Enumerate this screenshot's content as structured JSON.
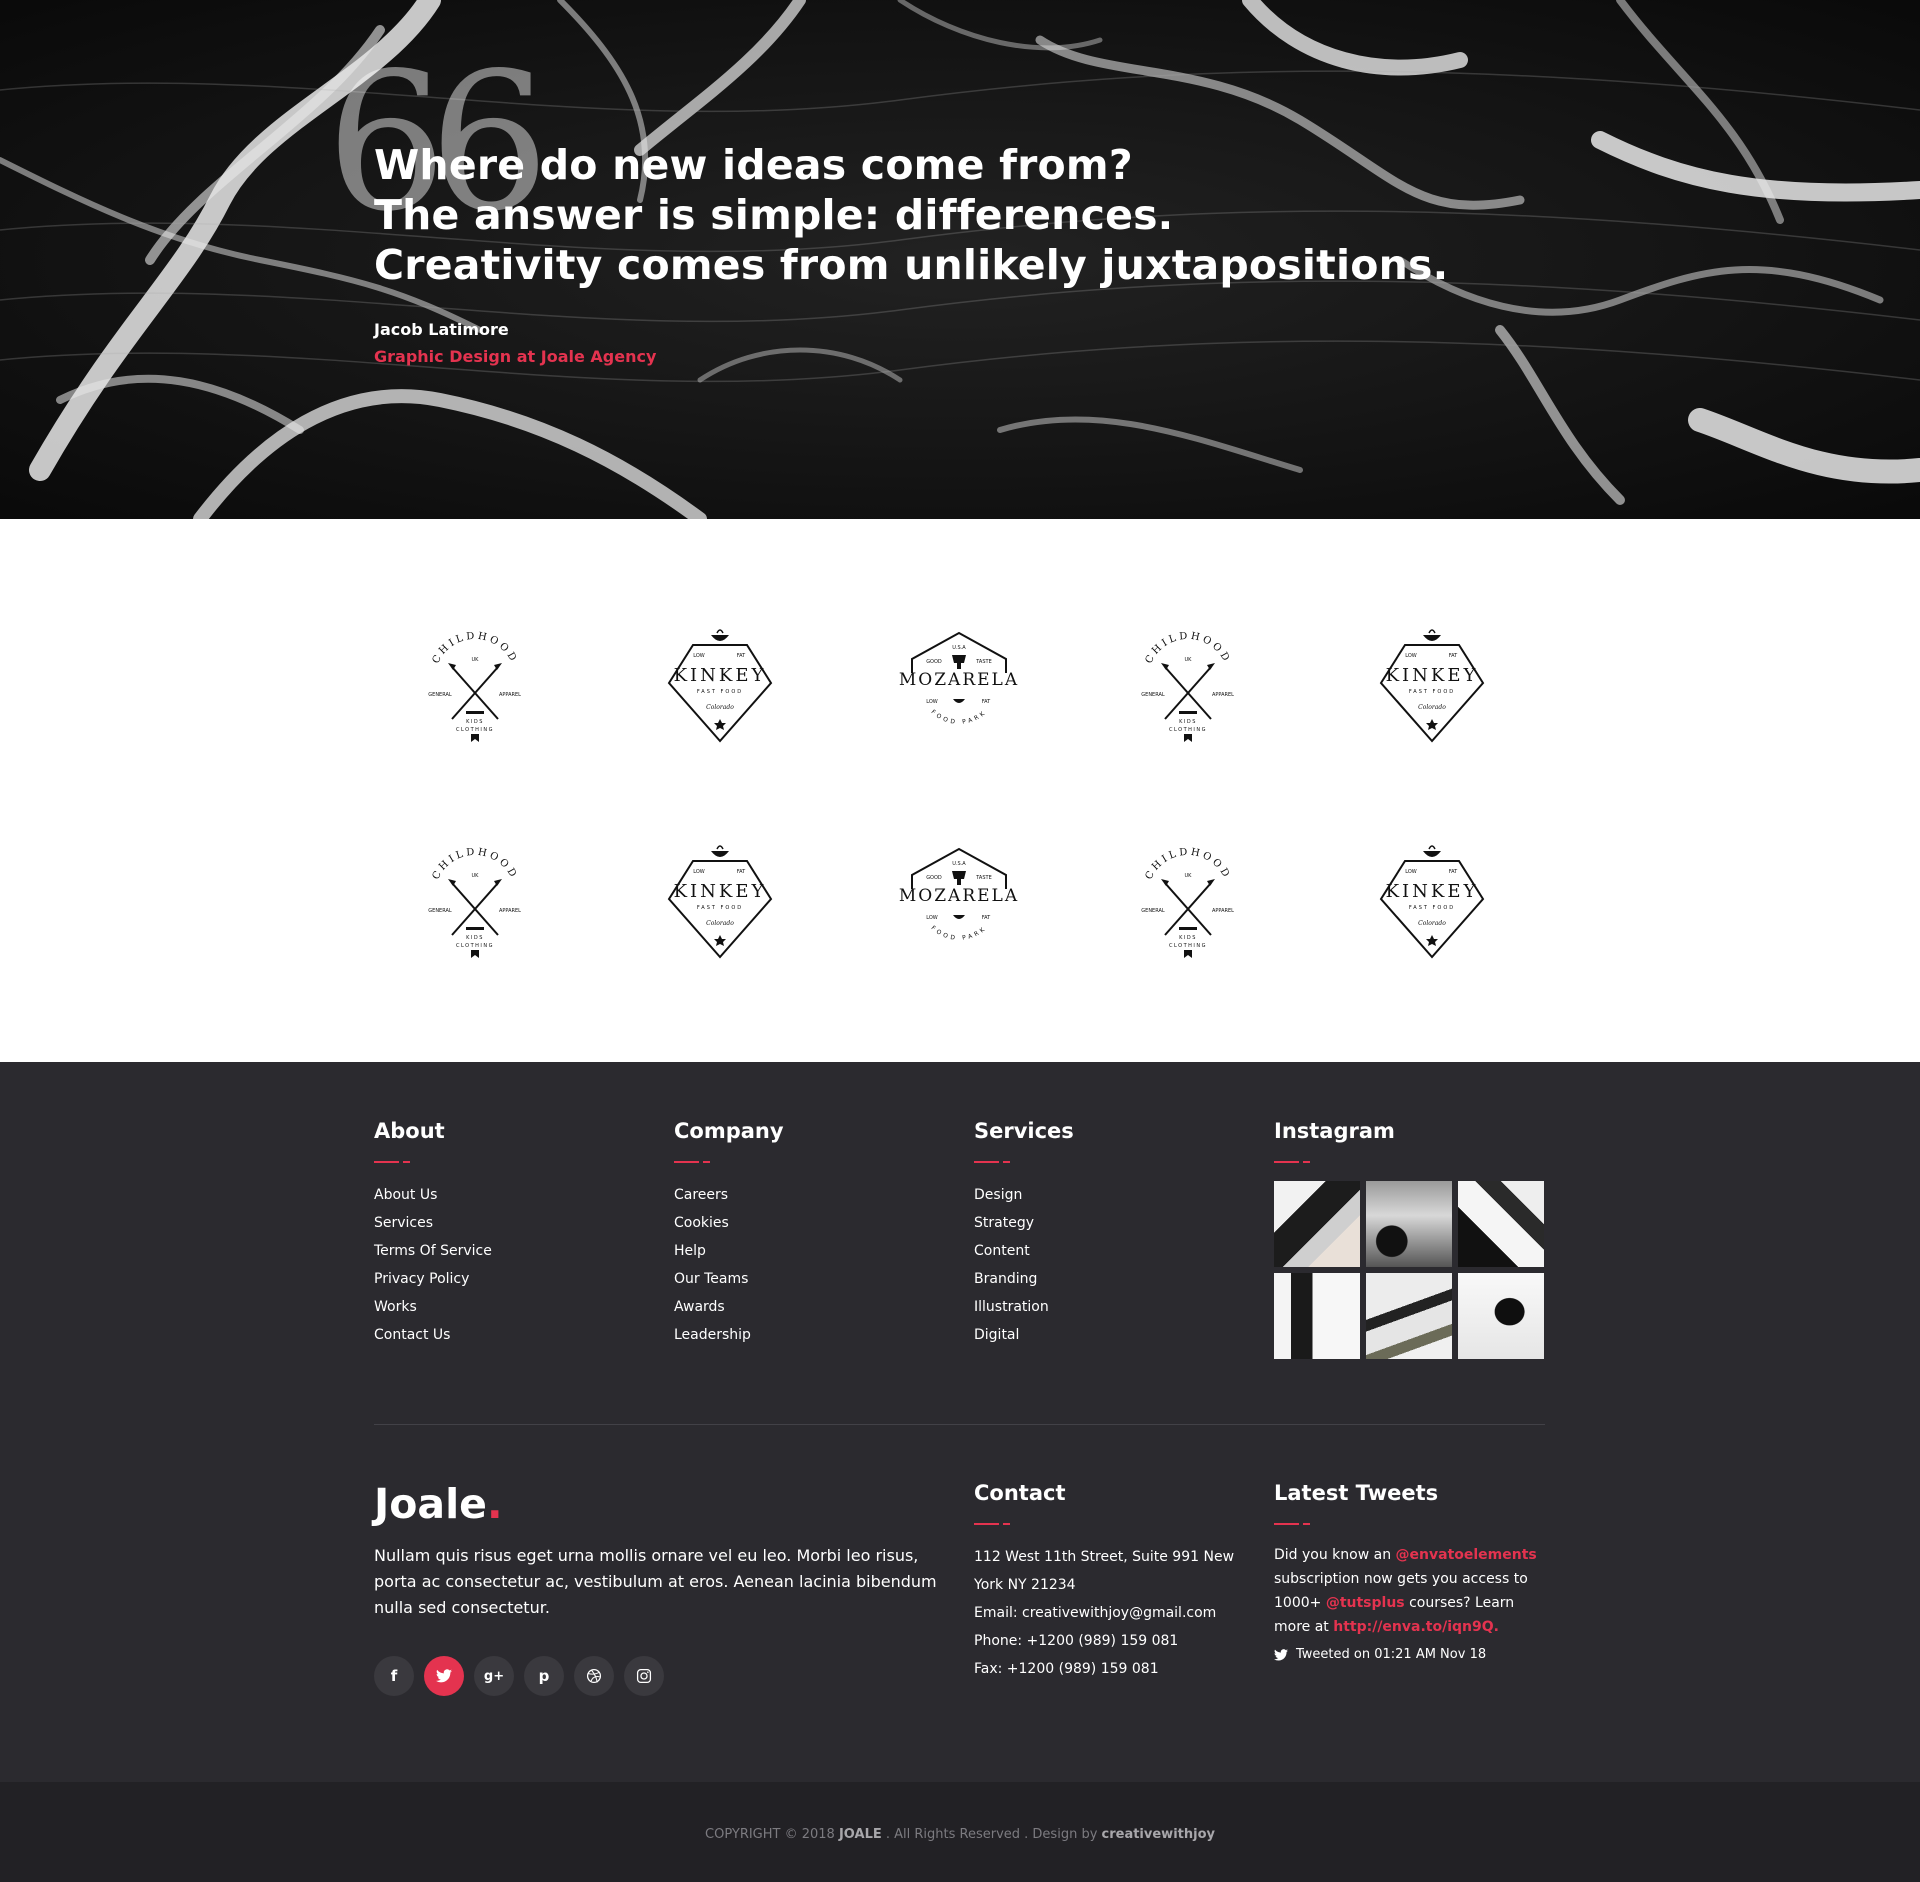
{
  "hero": {
    "quote_mark": "66",
    "quote_lines": [
      "Where do new ideas come from?",
      "The answer is simple: differences.",
      "Creativity comes from unlikely juxtapositions."
    ],
    "author": "Jacob Latimore",
    "role": "Graphic Design at Joale Agency"
  },
  "logos": [
    {
      "name": "CHILDHOOD",
      "top": "CHILDHOOD",
      "sub": "UK",
      "left": "GENERAL",
      "right": "APPAREL",
      "bottom1": "KIDS",
      "bottom2": "CLOTHING"
    },
    {
      "name": "KINKEY",
      "top1": "LOW",
      "top2": "FAT",
      "word": "KINKEY",
      "sub": "FAST FOOD",
      "script": "Colorado"
    },
    {
      "name": "MOZARELA",
      "top": "U.S.A",
      "top1": "GOOD",
      "top2": "TASTE",
      "word": "MOZARELA",
      "low1": "LOW",
      "low2": "FAT",
      "sub": "FOOD PARK"
    }
  ],
  "footer": {
    "about": {
      "title": "About",
      "items": [
        "About Us",
        "Services",
        "Terms Of Service",
        "Privacy Policy",
        "Works",
        "Contact Us"
      ]
    },
    "company": {
      "title": "Company",
      "items": [
        "Careers",
        "Cookies",
        "Help",
        "Our Teams",
        "Awards",
        "Leadership"
      ]
    },
    "services": {
      "title": "Services",
      "items": [
        "Design",
        "Strategy",
        "Content",
        "Branding",
        "Illustration",
        "Digital"
      ]
    },
    "instagram": {
      "title": "Instagram"
    },
    "brand": {
      "name": "Joale",
      "dot": ".",
      "text": "Nullam quis risus eget urna mollis ornare vel eu leo. Morbi leo risus, porta ac consectetur ac, vestibulum at eros. Aenean lacinia bibendum nulla sed consectetur."
    },
    "socials": [
      "f",
      "twitter",
      "g+",
      "p",
      "dribbble",
      "instagram"
    ],
    "contact": {
      "title": "Contact",
      "address": "112 West 11th Street, Suite 991 New York NY 21234",
      "email": "Email: creativewithjoy@gmail.com",
      "phone": "Phone: +1200 (989) 159 081",
      "fax": "Fax: +1200 (989) 159 081"
    },
    "tweets": {
      "title": "Latest Tweets",
      "t1": "Did you know an ",
      "handle1": "@envatoelements",
      "t2": " subscription now gets you access to 1000+ ",
      "handle2": "@tutsplus",
      "t3": " courses? Learn more at ",
      "link": "http://enva.to/iqn9Q.",
      "meta": "Tweeted on 01:21 AM Nov 18"
    }
  },
  "copyright": {
    "pre": "COPYRIGHT © 2018 ",
    "brand": "JOALE",
    "mid": " . All Rights Reserved . Design by ",
    "designer": "creativewithjoy"
  },
  "colors": {
    "accent": "#e4334f",
    "footer_bg": "#2b2a2f",
    "bottom_bg": "#222125"
  }
}
